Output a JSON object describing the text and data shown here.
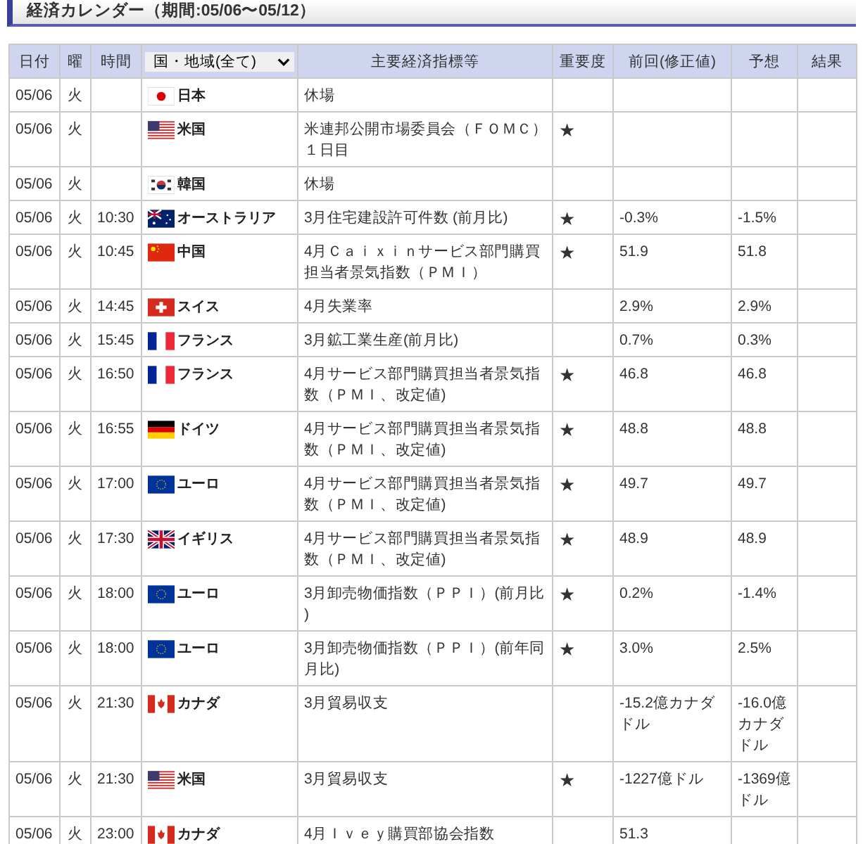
{
  "title": "経済カレンダー（期間:05/06〜05/12）",
  "columns": [
    "日付",
    "曜",
    "時間",
    {
      "filter": "国・地域(全て)"
    },
    "主要経済指標等",
    "重要度",
    "前回(修正値)",
    "予想",
    "結果"
  ],
  "rows": [
    {
      "date": "05/06",
      "weekday": "火",
      "kind": "jp",
      "country": "日本",
      "indicator": "休場"
    },
    {
      "date": "05/06",
      "weekday": "火",
      "kind": "us",
      "country": "米国",
      "indicator": "米連邦公開市場委員会（ＦＯＭＣ）１日目",
      "importance": "★"
    },
    {
      "date": "05/06",
      "weekday": "火",
      "kind": "kr",
      "country": "韓国",
      "indicator": "休場"
    },
    {
      "date": "05/06",
      "weekday": "火",
      "time": "10:30",
      "kind": "au",
      "country": "オーストラリア",
      "indicator": "3月住宅建設許可件数 (前月比)",
      "importance": "★",
      "previous": "-0.3%",
      "forecast": "-1.5%"
    },
    {
      "date": "05/06",
      "weekday": "火",
      "time": "10:45",
      "kind": "cn",
      "country": "中国",
      "indicator": "4月Ｃａｉｘｉｎサービス部門購買担当者景気指数（ＰＭＩ）",
      "importance": "★",
      "previous": "51.9",
      "forecast": "51.8"
    },
    {
      "date": "05/06",
      "weekday": "火",
      "time": "14:45",
      "kind": "ch",
      "country": "スイス",
      "indicator": "4月失業率",
      "previous": "2.9%",
      "forecast": "2.9%"
    },
    {
      "date": "05/06",
      "weekday": "火",
      "time": "15:45",
      "kind": "fr",
      "country": "フランス",
      "indicator": "3月鉱工業生産(前月比)",
      "previous": "0.7%",
      "forecast": "0.3%"
    },
    {
      "date": "05/06",
      "weekday": "火",
      "time": "16:50",
      "kind": "fr",
      "country": "フランス",
      "indicator": "4月サービス部門購買担当者景気指数（ＰＭＩ、改定値)",
      "importance": "★",
      "previous": "46.8",
      "forecast": "46.8"
    },
    {
      "date": "05/06",
      "weekday": "火",
      "time": "16:55",
      "kind": "de",
      "country": "ドイツ",
      "indicator": "4月サービス部門購買担当者景気指数（ＰＭＩ、改定値)",
      "importance": "★",
      "previous": "48.8",
      "forecast": "48.8"
    },
    {
      "date": "05/06",
      "weekday": "火",
      "time": "17:00",
      "kind": "eu",
      "country": "ユーロ",
      "indicator": "4月サービス部門購買担当者景気指数（ＰＭＩ、改定値)",
      "importance": "★",
      "previous": "49.7",
      "forecast": "49.7"
    },
    {
      "date": "05/06",
      "weekday": "火",
      "time": "17:30",
      "kind": "gb",
      "country": "イギリス",
      "indicator": "4月サービス部門購買担当者景気指数（ＰＭＩ、改定値)",
      "importance": "★",
      "previous": "48.9",
      "forecast": "48.9"
    },
    {
      "date": "05/06",
      "weekday": "火",
      "time": "18:00",
      "kind": "eu",
      "country": "ユーロ",
      "indicator": "3月卸売物価指数（ＰＰＩ）(前月比)",
      "importance": "★",
      "previous": "0.2%",
      "forecast": "-1.4%"
    },
    {
      "date": "05/06",
      "weekday": "火",
      "time": "18:00",
      "kind": "eu",
      "country": "ユーロ",
      "indicator": "3月卸売物価指数（ＰＰＩ）(前年同月比)",
      "importance": "★",
      "previous": "3.0%",
      "forecast": "2.5%"
    },
    {
      "date": "05/06",
      "weekday": "火",
      "time": "21:30",
      "kind": "ca",
      "country": "カナダ",
      "indicator": "3月貿易収支",
      "previous": "-15.2億カナダドル",
      "forecast": "-16.0億カナダドル"
    },
    {
      "date": "05/06",
      "weekday": "火",
      "time": "21:30",
      "kind": "us",
      "country": "米国",
      "indicator": "3月貿易収支",
      "importance": "★",
      "previous": "-1227億ドル",
      "forecast": "-1369億ドル"
    },
    {
      "date": "05/06",
      "weekday": "火",
      "time": "23:00",
      "kind": "ca",
      "country": "カナダ",
      "indicator": "4月Ｉｖｅｙ購買部協会指数",
      "previous": "51.3"
    }
  ]
}
